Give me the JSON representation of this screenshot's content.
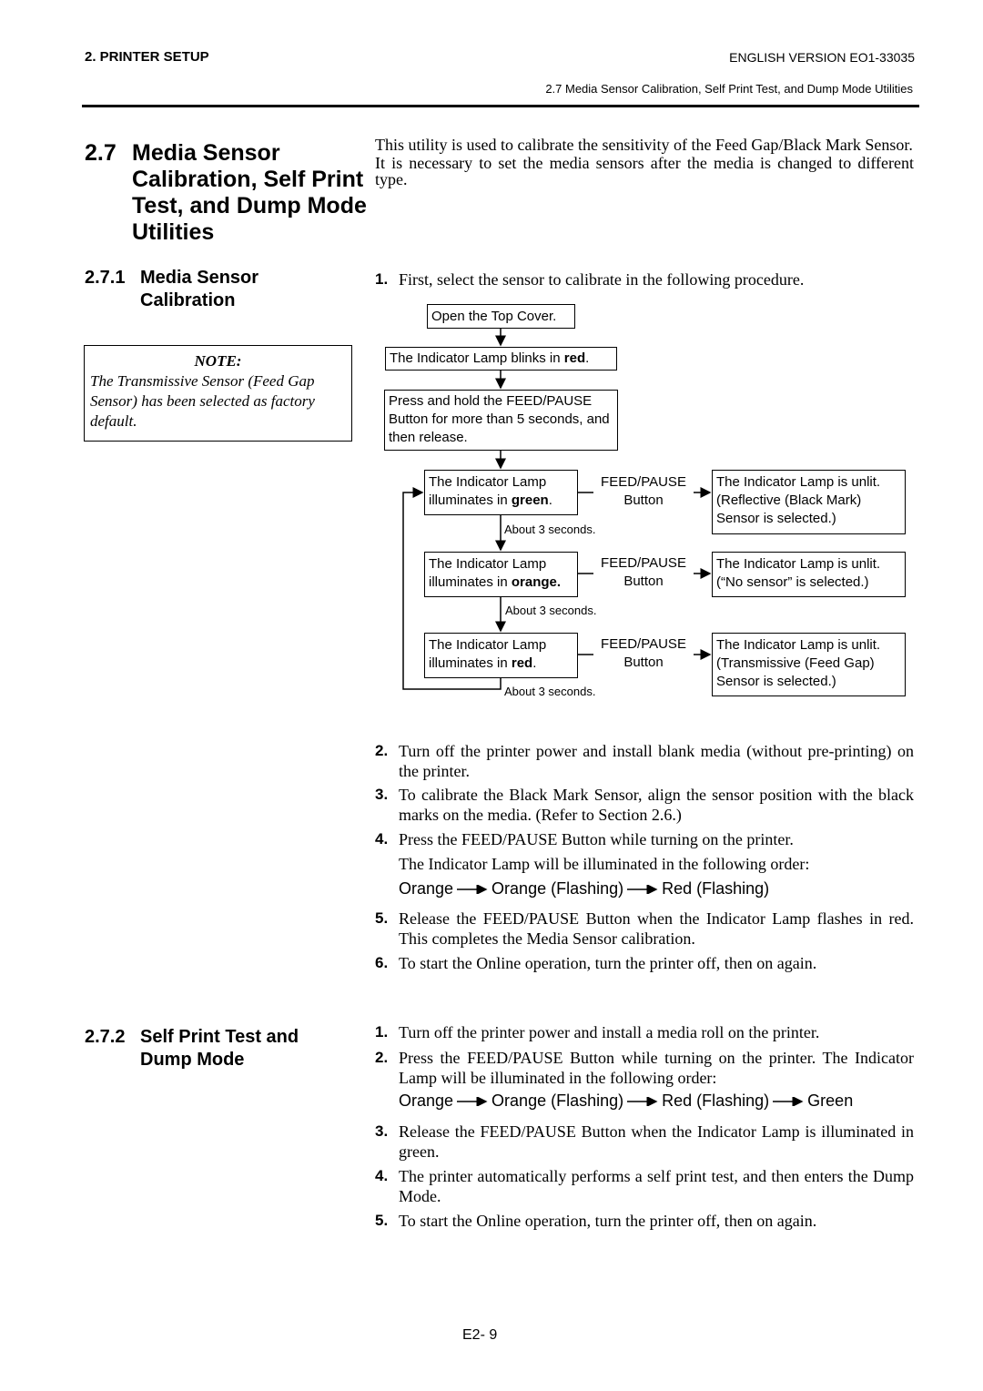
{
  "header": {
    "section": "2. PRINTER SETUP",
    "version": "ENGLISH VERSION EO1-33035",
    "subtitle": "2.7 Media Sensor Calibration, Self Print Test, and Dump Mode Utilities"
  },
  "section": {
    "number": "2.7",
    "title_lines": [
      "Media Sensor",
      "Calibration, Self Print",
      "Test, and Dump Mode",
      "Utilities"
    ],
    "intro": [
      "This utility is used to calibrate the sensitivity of the Feed Gap/Black Mark Sensor.",
      "It is necessary to set the media sensors after the media is changed to different type."
    ]
  },
  "sub1": {
    "number": "2.7.1",
    "title_lines": [
      "Media Sensor",
      "Calibration"
    ],
    "note_label": "NOTE:",
    "note_text": "The Transmissive Sensor (Feed Gap Sensor) has been selected as factory default.",
    "steps": [
      {
        "n": "1.",
        "text": "First, select the sensor to calibrate in the following procedure."
      },
      {
        "n": "2.",
        "text": "Turn off the printer power and install blank media (without pre-printing) on the printer."
      },
      {
        "n": "3.",
        "text": "To calibrate the Black Mark Sensor, align the sensor position with the black marks on the media. (Refer to Section 2.6.)"
      },
      {
        "n": "4.",
        "text": "Press the FEED/PAUSE Button while turning on the printer.",
        "extra": "The Indicator Lamp will be illuminated in the following order:"
      },
      {
        "n": "5.",
        "text": "Release the FEED/PAUSE Button when the Indicator Lamp flashes in red. This completes the Media Sensor calibration."
      },
      {
        "n": "6.",
        "text": "To start the Online operation, turn the printer off, then on again."
      }
    ],
    "sequence": [
      "Orange",
      "Orange (Flashing)",
      "Red (Flashing)"
    ]
  },
  "flow": {
    "open": "Open the Top Cover.",
    "blink_pre": "The Indicator Lamp blinks in ",
    "blink_bold": "red",
    "blink_post": ".",
    "press": "Press and hold the FEED/PAUSE Button for more than 5 seconds, and then release.",
    "lamp_pre": "The Indicator Lamp illuminates in ",
    "green": "green",
    "orange": "orange.",
    "red": "red",
    "button_line1": "FEED/PAUSE",
    "button_line2": "Button",
    "about": "About 3 seconds.",
    "result1": "The Indicator Lamp is unlit. (Reflective (Black Mark) Sensor is selected.)",
    "result2": "The Indicator Lamp is unlit. (“No sensor” is selected.)",
    "result3": "The Indicator Lamp is unlit. (Transmissive (Feed Gap) Sensor is selected.)"
  },
  "sub2": {
    "number": "2.7.2",
    "title_lines": [
      "Self Print Test and",
      "Dump Mode"
    ],
    "steps": [
      {
        "n": "1.",
        "text": "Turn off the printer power and install a media roll on the printer."
      },
      {
        "n": "2.",
        "text": "Press the FEED/PAUSE Button while turning on the printer. The Indicator Lamp will be illuminated in the following order:"
      },
      {
        "n": "3.",
        "text": "Release the FEED/PAUSE Button when the Indicator Lamp is illuminated in green."
      },
      {
        "n": "4.",
        "text": "The printer automatically performs a self print test, and then enters the Dump Mode."
      },
      {
        "n": "5.",
        "text": "To start the Online operation, turn the printer off, then on again."
      }
    ],
    "sequence": [
      "Orange",
      "Orange (Flashing)",
      "Red (Flashing)",
      "Green"
    ]
  },
  "footer": {
    "page": "E2- 9"
  }
}
